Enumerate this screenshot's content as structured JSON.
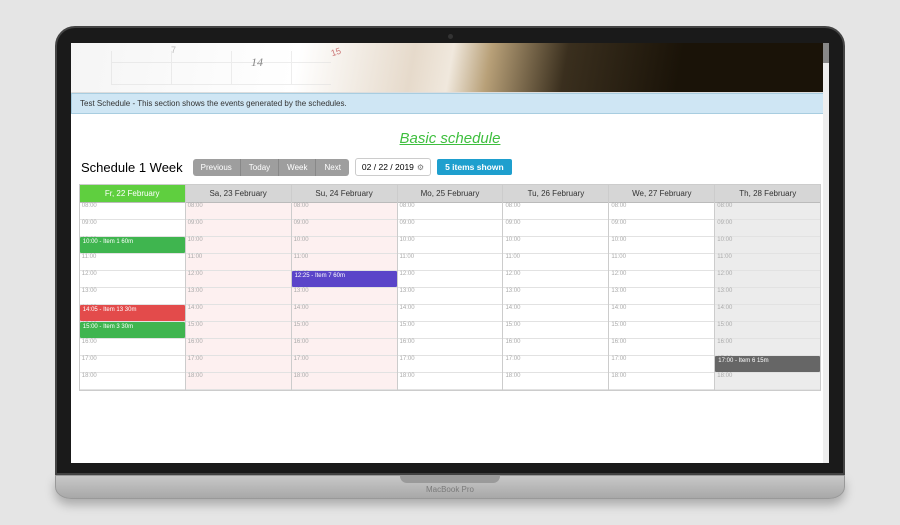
{
  "hero": {
    "num1": "7",
    "num2": "14",
    "num3": "15"
  },
  "banner": "Test Schedule - This section shows the events generated by the schedules.",
  "page_link": "Basic schedule",
  "schedule_title": "Schedule 1 Week",
  "nav": {
    "prev": "Previous",
    "today": "Today",
    "week": "Week",
    "next": "Next"
  },
  "date_value": "02 / 22 / 2019",
  "items_shown": "5 items shown",
  "hours": [
    "08:00",
    "09:00",
    "10:00",
    "11:00",
    "12:00",
    "13:00",
    "14:00",
    "15:00",
    "16:00",
    "17:00",
    "18:00"
  ],
  "days": [
    {
      "label": "Fr, 22 February",
      "today": true,
      "weekend": false
    },
    {
      "label": "Sa, 23 February",
      "today": false,
      "weekend": true
    },
    {
      "label": "Su, 24 February",
      "today": false,
      "weekend": true
    },
    {
      "label": "Mo, 25 February",
      "today": false,
      "weekend": false
    },
    {
      "label": "Tu, 26 February",
      "today": false,
      "weekend": false
    },
    {
      "label": "We, 27 February",
      "today": false,
      "weekend": false
    },
    {
      "label": "Th, 28 February",
      "today": false,
      "weekend": false
    }
  ],
  "events": [
    {
      "day": 0,
      "hour_index": 2,
      "span": 1,
      "color": "green",
      "label": "10:00 - Item 1 60m"
    },
    {
      "day": 0,
      "hour_index": 6,
      "span": 1,
      "color": "red",
      "label": "14:05 - Item 13 30m"
    },
    {
      "day": 0,
      "hour_index": 7,
      "span": 1,
      "color": "green",
      "label": "15:00 - Item 3 30m"
    },
    {
      "day": 2,
      "hour_index": 4,
      "span": 1,
      "color": "purple",
      "label": "12:25 - Item 7 60m"
    },
    {
      "day": 6,
      "hour_index": 9,
      "span": 1,
      "color": "grey",
      "label": "17:00 - Item 6 15m"
    }
  ],
  "laptop_brand": "MacBook Pro"
}
